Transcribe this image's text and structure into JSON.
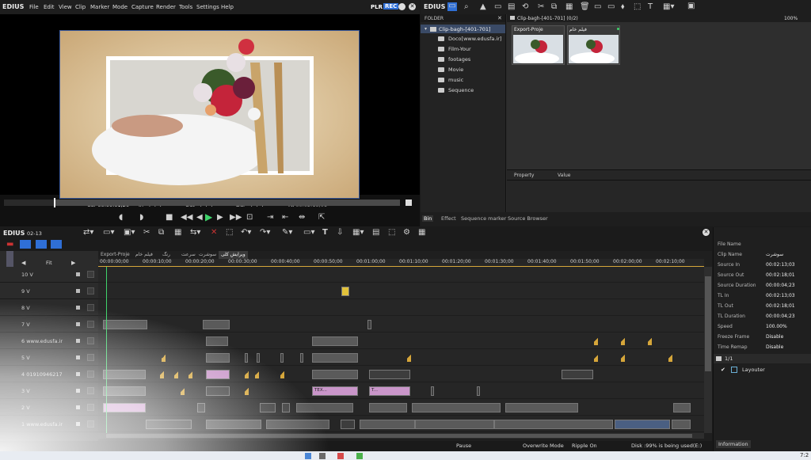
{
  "player": {
    "brand": "EDIUS",
    "menu": [
      "File",
      "Edit",
      "View",
      "Clip",
      "Marker",
      "Mode",
      "Capture",
      "Render",
      "Tools",
      "Settings",
      "Help"
    ],
    "mode_plr": "PLR",
    "mode_rec": "REC",
    "timecodes": {
      "cur_label": "Cur",
      "cur": "00:00:01;20",
      "in_label": "In",
      "in": "--:--:--:--",
      "out_label": "Out",
      "out": "--:--:--:--",
      "dur_label": "Dur",
      "dur": "--:--:--:--",
      "ttl_label": "Ttl",
      "ttl": "00:02:18;01"
    }
  },
  "bin": {
    "brand": "EDIUS",
    "folder_header": "FOLDER",
    "root": "Clip-bagh-[401-701]",
    "folders": [
      "Doco[www.edusfa.ir]",
      "Film-Your",
      "footages",
      "Movie",
      "music",
      "Sequence"
    ],
    "path": "Clip-bagh-[401-701] (0/2)",
    "zoom": "100%",
    "clips": [
      {
        "name": "Export-Proje"
      },
      {
        "name": "فیلم خام"
      }
    ],
    "prop_col": "Property",
    "value_col": "Value",
    "tabs": [
      "Bin",
      "Effect",
      "Sequence marker",
      "Source Browser"
    ]
  },
  "timeline": {
    "brand": "EDIUS",
    "sequence_code": "02-13",
    "fit_label": "Fit",
    "seq_tabs": [
      "Export-Proje",
      "فیلم خام",
      "رنگ",
      "سرعت",
      "سوشرت",
      "ویرایش کلی"
    ],
    "ruler": [
      "00:00:00;00",
      "00:00:10;00",
      "00:00:20;00",
      "00:00:30;00",
      "00:00:40;00",
      "00:00:50;00",
      "00:01:00;00",
      "00:01:10;00",
      "00:01:20;00",
      "00:01:30;00",
      "00:01:40;00",
      "00:01:50;00",
      "00:02:00;00",
      "00:02:10;00"
    ],
    "tracks": [
      "10 V",
      "9 V",
      "8 V",
      "7 V",
      "6 www.edusfa.ir",
      "5 V",
      "4 01910946217",
      "3 V",
      "2 V",
      "1 www.edusfa.ir"
    ],
    "clip_text_tex": "TEX...",
    "clip_text_t": "T...",
    "status": {
      "pause": "Pause",
      "overwrite": "Overwrite Mode",
      "ripple": "Ripple On",
      "disk": "Disk :99% is being used(E:)"
    }
  },
  "info": {
    "rows": [
      {
        "k": "File Name",
        "v": ""
      },
      {
        "k": "Clip Name",
        "v": "سوشرت"
      },
      {
        "k": "Source In",
        "v": "00:02:13;03"
      },
      {
        "k": "Source Out",
        "v": "00:02:18;01"
      },
      {
        "k": "Source Duration",
        "v": "00:00:04;23"
      },
      {
        "k": "TL In",
        "v": "00:02:13;03"
      },
      {
        "k": "TL Out",
        "v": "00:02:18;01"
      },
      {
        "k": "TL Duration",
        "v": "00:00:04;23"
      },
      {
        "k": "Speed",
        "v": "100.00%"
      },
      {
        "k": "Freeze Frame",
        "v": "Disable"
      },
      {
        "k": "Time Remap",
        "v": "Disable"
      }
    ],
    "layer_count": "1/1",
    "layouter": "Layouter",
    "tab": "Information"
  },
  "taskbar": {
    "clock": "7:2"
  }
}
